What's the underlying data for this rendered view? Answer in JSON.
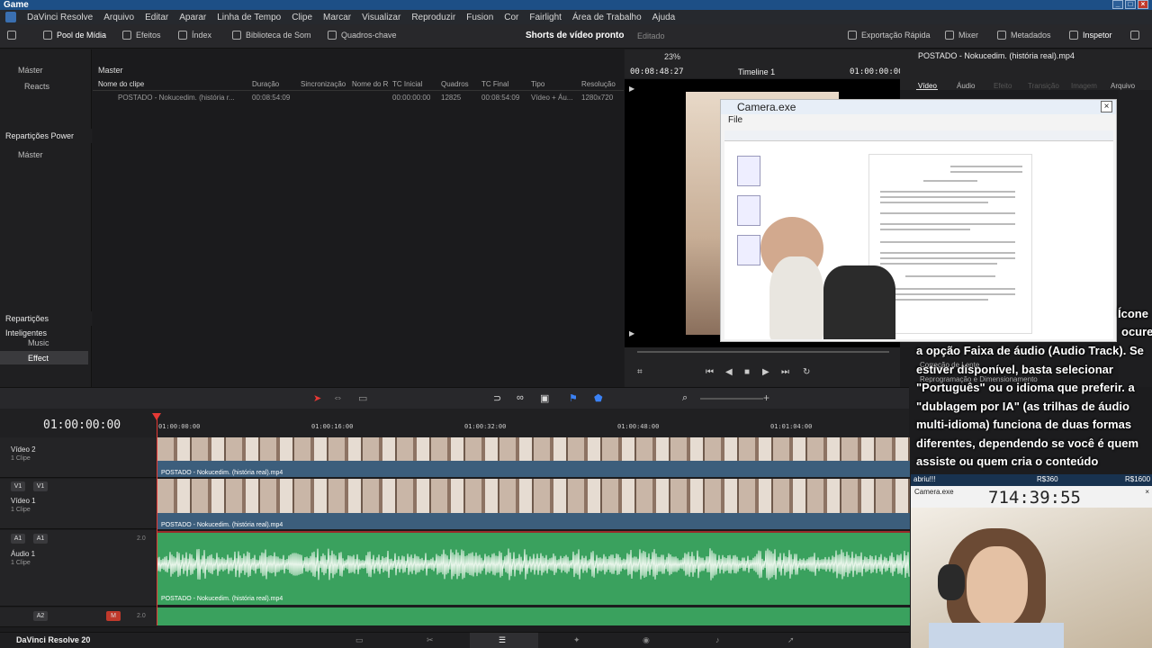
{
  "window": {
    "title": "Game"
  },
  "menu": [
    "DaVinci Resolve",
    "Arquivo",
    "Editar",
    "Aparar",
    "Linha de Tempo",
    "Clipe",
    "Marcar",
    "Visualizar",
    "Reproduzir",
    "Fusion",
    "Cor",
    "Fairlight",
    "Área de Trabalho",
    "Ajuda"
  ],
  "toolbar": {
    "media_pool": "Pool de Mídia",
    "effects": "Efeitos",
    "index": "Índex",
    "sound_library": "Biblioteca de Som",
    "keyframes": "Quadros-chave",
    "project_title": "Shorts de vídeo pronto",
    "project_state": "Editado",
    "quick_export": "Exportação Rápida",
    "mixer": "Mixer",
    "metadata": "Metadados",
    "inspector": "Inspetor"
  },
  "left_panel": {
    "master": "Máster",
    "reacts": "Reacts",
    "power_bins": "Repartições Power",
    "power_master": "Máster",
    "smart_bins": "Repartições Inteligentes",
    "music": "Music",
    "effect": "Effect"
  },
  "media_pool": {
    "header": "Master",
    "columns": [
      "Nome do clipe",
      "Duração",
      "Sincronização",
      "Nome do R",
      "TC Inicial",
      "Quadros",
      "TC Final",
      "Tipo",
      "Resolução"
    ],
    "row": [
      "POSTADO - Nokucedim. (história r...",
      "00:08:54:09",
      "",
      "",
      "00:00:00:00",
      "12825",
      "00:08:54:09",
      "Vídeo + Áu...",
      "1280x720"
    ]
  },
  "viewer": {
    "zoom": "23%",
    "timecode_left": "00:08:48:27",
    "timeline_name": "Timeline 1",
    "timecode_right": "01:00:00:00"
  },
  "inspector": {
    "clip_name": "POSTADO - Nokucedim. (história real).mp4",
    "tabs": [
      "Vídeo",
      "Áudio",
      "Efeito",
      "Transição",
      "Imagem",
      "Arquivo"
    ]
  },
  "camera_window": {
    "title": "Camera.exe",
    "menu": "File"
  },
  "captions": {
    "line0": "Ícone",
    "line0b": "ocure",
    "line1": "a opção Faixa de áudio (Audio Track). Se",
    "line2": "estiver disponível, basta selecionar",
    "line3": "\"Português\" ou o idioma que preferir. a",
    "line4": "\"dublagem por IA\" (as trilhas de áudio",
    "line5": "multi-idioma) funciona de duas formas",
    "line6": "diferentes, dependendo se você é quem",
    "line7": "assiste ou quem cria o conteúdo",
    "bg1": "Correção de Lente",
    "bg2": "Reprogramação e Dimensionamento"
  },
  "timeline": {
    "timecode": "01:00:00:00",
    "ruler": [
      "01:00:00:00",
      "01:00:16:00",
      "01:00:32:00",
      "01:00:48:00",
      "01:01:04:00"
    ],
    "tracks": {
      "v2": {
        "name": "Vídeo 2",
        "clips": "1 Clipe"
      },
      "v1": {
        "name": "Vídeo 1",
        "clips": "1 Clipe",
        "badge1": "V1",
        "badge2": "V1"
      },
      "a1": {
        "name": "Áudio 1",
        "clips": "1 Clipe",
        "badge1": "A1",
        "badge2": "A1",
        "channels": "2.0"
      },
      "a2": {
        "badge": "A2",
        "channels": "2.0",
        "m": "M"
      }
    },
    "clip_v2": "POSTADO - Nokucedim. (história real).mp4",
    "clip_v1": "POSTADO - Nokucedim. (história real).mp4",
    "clip_a1": "POSTADO - Nokucedim. (história real).mp4"
  },
  "bottom": {
    "app_name": "DaVinci Resolve 20"
  },
  "webcam": {
    "chat_name": "abriu!!!",
    "amount1": "R$360",
    "amount2": "R$1600",
    "window_title": "Camera.exe",
    "counter": "714:39:55"
  }
}
